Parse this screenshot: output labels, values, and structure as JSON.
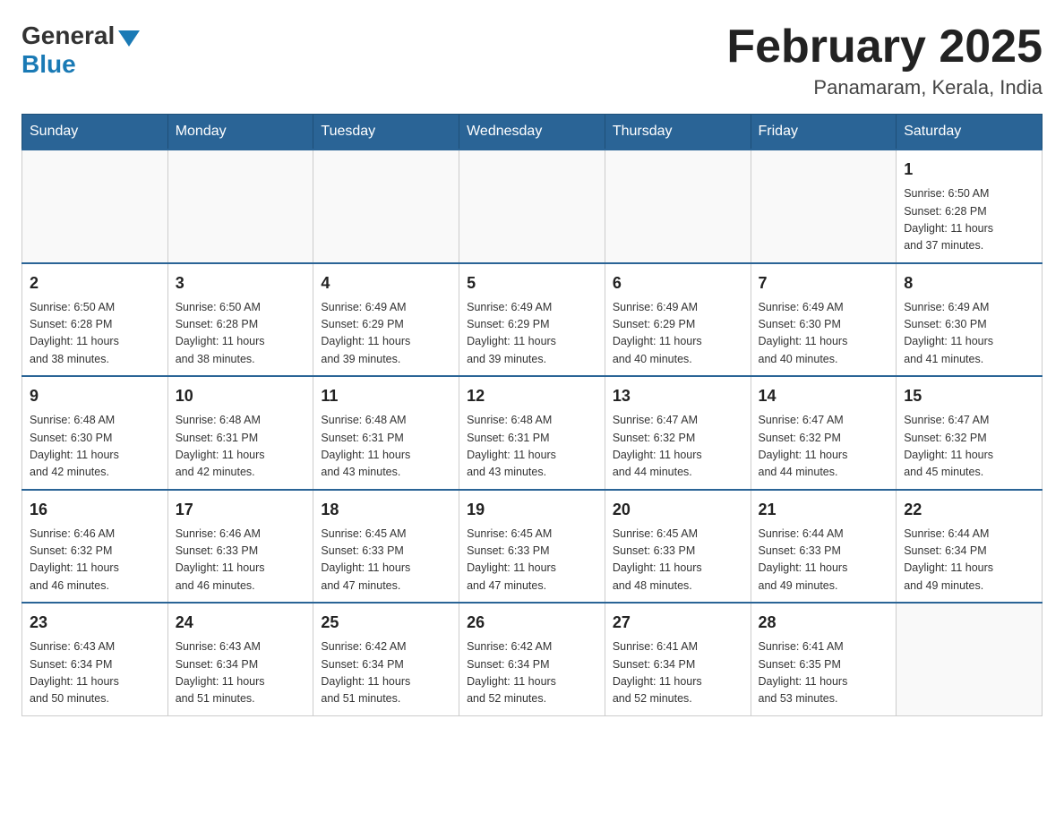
{
  "header": {
    "logo_general": "General",
    "logo_blue": "Blue",
    "month_title": "February 2025",
    "location": "Panamaram, Kerala, India"
  },
  "weekdays": [
    "Sunday",
    "Monday",
    "Tuesday",
    "Wednesday",
    "Thursday",
    "Friday",
    "Saturday"
  ],
  "weeks": [
    [
      {
        "day": "",
        "info": ""
      },
      {
        "day": "",
        "info": ""
      },
      {
        "day": "",
        "info": ""
      },
      {
        "day": "",
        "info": ""
      },
      {
        "day": "",
        "info": ""
      },
      {
        "day": "",
        "info": ""
      },
      {
        "day": "1",
        "info": "Sunrise: 6:50 AM\nSunset: 6:28 PM\nDaylight: 11 hours\nand 37 minutes."
      }
    ],
    [
      {
        "day": "2",
        "info": "Sunrise: 6:50 AM\nSunset: 6:28 PM\nDaylight: 11 hours\nand 38 minutes."
      },
      {
        "day": "3",
        "info": "Sunrise: 6:50 AM\nSunset: 6:28 PM\nDaylight: 11 hours\nand 38 minutes."
      },
      {
        "day": "4",
        "info": "Sunrise: 6:49 AM\nSunset: 6:29 PM\nDaylight: 11 hours\nand 39 minutes."
      },
      {
        "day": "5",
        "info": "Sunrise: 6:49 AM\nSunset: 6:29 PM\nDaylight: 11 hours\nand 39 minutes."
      },
      {
        "day": "6",
        "info": "Sunrise: 6:49 AM\nSunset: 6:29 PM\nDaylight: 11 hours\nand 40 minutes."
      },
      {
        "day": "7",
        "info": "Sunrise: 6:49 AM\nSunset: 6:30 PM\nDaylight: 11 hours\nand 40 minutes."
      },
      {
        "day": "8",
        "info": "Sunrise: 6:49 AM\nSunset: 6:30 PM\nDaylight: 11 hours\nand 41 minutes."
      }
    ],
    [
      {
        "day": "9",
        "info": "Sunrise: 6:48 AM\nSunset: 6:30 PM\nDaylight: 11 hours\nand 42 minutes."
      },
      {
        "day": "10",
        "info": "Sunrise: 6:48 AM\nSunset: 6:31 PM\nDaylight: 11 hours\nand 42 minutes."
      },
      {
        "day": "11",
        "info": "Sunrise: 6:48 AM\nSunset: 6:31 PM\nDaylight: 11 hours\nand 43 minutes."
      },
      {
        "day": "12",
        "info": "Sunrise: 6:48 AM\nSunset: 6:31 PM\nDaylight: 11 hours\nand 43 minutes."
      },
      {
        "day": "13",
        "info": "Sunrise: 6:47 AM\nSunset: 6:32 PM\nDaylight: 11 hours\nand 44 minutes."
      },
      {
        "day": "14",
        "info": "Sunrise: 6:47 AM\nSunset: 6:32 PM\nDaylight: 11 hours\nand 44 minutes."
      },
      {
        "day": "15",
        "info": "Sunrise: 6:47 AM\nSunset: 6:32 PM\nDaylight: 11 hours\nand 45 minutes."
      }
    ],
    [
      {
        "day": "16",
        "info": "Sunrise: 6:46 AM\nSunset: 6:32 PM\nDaylight: 11 hours\nand 46 minutes."
      },
      {
        "day": "17",
        "info": "Sunrise: 6:46 AM\nSunset: 6:33 PM\nDaylight: 11 hours\nand 46 minutes."
      },
      {
        "day": "18",
        "info": "Sunrise: 6:45 AM\nSunset: 6:33 PM\nDaylight: 11 hours\nand 47 minutes."
      },
      {
        "day": "19",
        "info": "Sunrise: 6:45 AM\nSunset: 6:33 PM\nDaylight: 11 hours\nand 47 minutes."
      },
      {
        "day": "20",
        "info": "Sunrise: 6:45 AM\nSunset: 6:33 PM\nDaylight: 11 hours\nand 48 minutes."
      },
      {
        "day": "21",
        "info": "Sunrise: 6:44 AM\nSunset: 6:33 PM\nDaylight: 11 hours\nand 49 minutes."
      },
      {
        "day": "22",
        "info": "Sunrise: 6:44 AM\nSunset: 6:34 PM\nDaylight: 11 hours\nand 49 minutes."
      }
    ],
    [
      {
        "day": "23",
        "info": "Sunrise: 6:43 AM\nSunset: 6:34 PM\nDaylight: 11 hours\nand 50 minutes."
      },
      {
        "day": "24",
        "info": "Sunrise: 6:43 AM\nSunset: 6:34 PM\nDaylight: 11 hours\nand 51 minutes."
      },
      {
        "day": "25",
        "info": "Sunrise: 6:42 AM\nSunset: 6:34 PM\nDaylight: 11 hours\nand 51 minutes."
      },
      {
        "day": "26",
        "info": "Sunrise: 6:42 AM\nSunset: 6:34 PM\nDaylight: 11 hours\nand 52 minutes."
      },
      {
        "day": "27",
        "info": "Sunrise: 6:41 AM\nSunset: 6:34 PM\nDaylight: 11 hours\nand 52 minutes."
      },
      {
        "day": "28",
        "info": "Sunrise: 6:41 AM\nSunset: 6:35 PM\nDaylight: 11 hours\nand 53 minutes."
      },
      {
        "day": "",
        "info": ""
      }
    ]
  ]
}
